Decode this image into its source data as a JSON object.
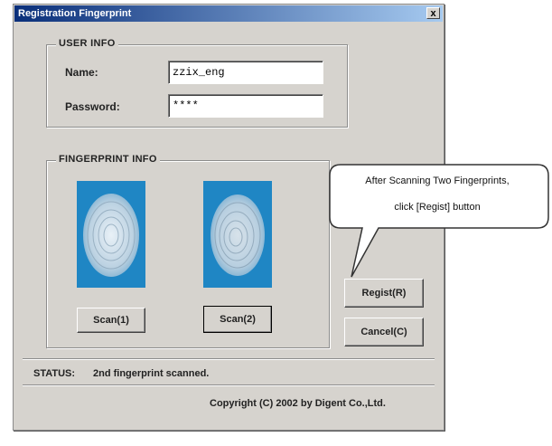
{
  "window": {
    "title": "Registration Fingerprint",
    "close_label": "x"
  },
  "user_info": {
    "group_title": "USER INFO",
    "name_label": "Name:",
    "name_value": "zzix_eng",
    "password_label": "Password:",
    "password_value": "****"
  },
  "fingerprint_info": {
    "group_title": "FINGERPRINT INFO",
    "scan1_label": "Scan(1)",
    "scan2_label": "Scan(2)"
  },
  "buttons": {
    "regist_label": "Regist(R)",
    "cancel_label": "Cancel(C)"
  },
  "status": {
    "label": "STATUS:",
    "text": "2nd fingerprint scanned."
  },
  "copyright": "Copyright (C) 2002 by Digent Co.,Ltd.",
  "callout": {
    "line1": "After Scanning Two Fingerprints,",
    "line2": "click [Regist] button"
  },
  "colors": {
    "window_bg": "#d6d3ce",
    "titlebar_start": "#0a2f7a",
    "fingerprint_bg": "#1f86c4"
  }
}
